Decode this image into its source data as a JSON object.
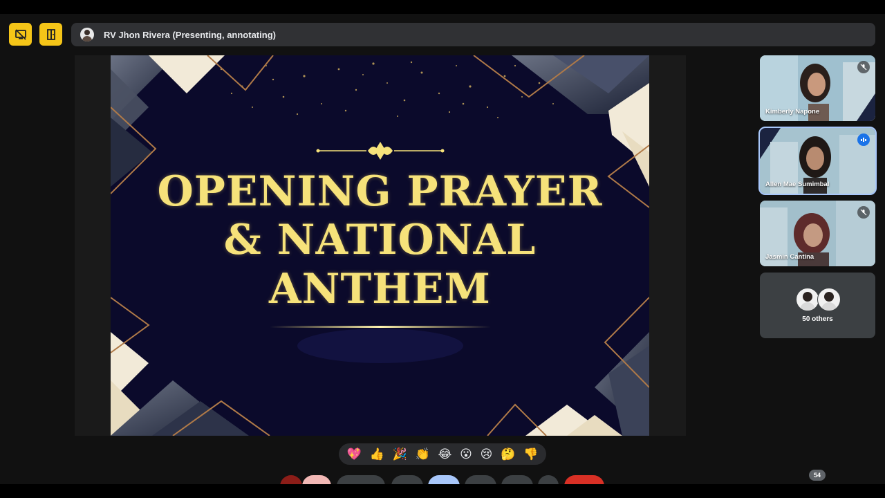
{
  "presenter": {
    "label": "RV Jhon Rivera (Presenting, annotating)"
  },
  "slide": {
    "line1": "OPENING PRAYER",
    "line2": "& NATIONAL",
    "line3": "ANTHEM"
  },
  "participants": [
    {
      "name": "Kimberly Napone",
      "state": "muted"
    },
    {
      "name": "Allen Mae Sumimbal",
      "state": "speaking"
    },
    {
      "name": "Jasmin Cantina",
      "state": "muted"
    }
  ],
  "others": {
    "label": "50 others"
  },
  "reactions": [
    "💖",
    "👍",
    "🎉",
    "👏",
    "😂",
    "😮",
    "😢",
    "🤔",
    "👎"
  ],
  "participant_count": "54",
  "colors": {
    "accent_yellow": "#f5c518",
    "slide_bg": "#0b0a2b",
    "gold": "#f6e27a",
    "end_call": "#d93025"
  }
}
